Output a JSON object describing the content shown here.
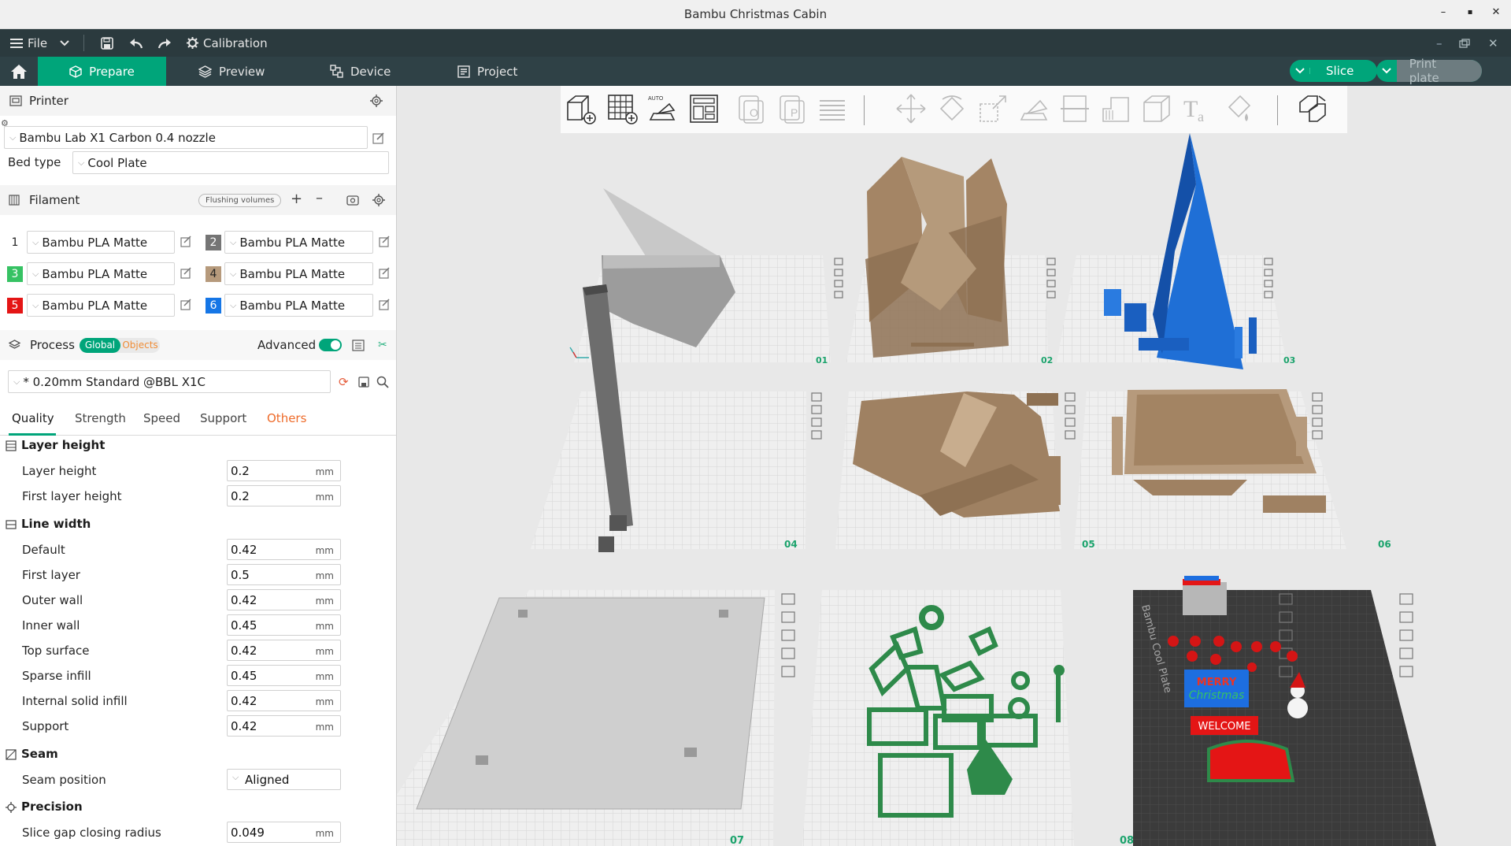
{
  "window": {
    "title": "Bambu Christmas Cabin",
    "controls": [
      "–",
      "▪",
      "✕"
    ]
  },
  "menubar": {
    "file_label": "File",
    "calibration_label": "Calibration"
  },
  "tabs": {
    "prepare": "Prepare",
    "preview": "Preview",
    "device": "Device",
    "project": "Project"
  },
  "actions": {
    "slice": "Slice",
    "print_plate": "Print plate"
  },
  "printer": {
    "section_title": "Printer",
    "preset": "Bambu Lab X1 Carbon 0.4 nozzle",
    "bed_type_label": "Bed type",
    "bed_type_value": "Cool Plate"
  },
  "filament": {
    "section_title": "Filament",
    "flushing_label": "Flushing volumes",
    "slots": [
      {
        "num": "1",
        "color": "#ffffff",
        "name": "Bambu PLA Matte"
      },
      {
        "num": "2",
        "color": "#757575",
        "name": "Bambu PLA Matte"
      },
      {
        "num": "3",
        "color": "#36c263",
        "name": "Bambu PLA Matte"
      },
      {
        "num": "4",
        "color": "#b69a7c",
        "name": "Bambu PLA Matte"
      },
      {
        "num": "5",
        "color": "#e41515",
        "name": "Bambu PLA Matte"
      },
      {
        "num": "6",
        "color": "#1576e6",
        "name": "Bambu PLA Matte"
      }
    ]
  },
  "process": {
    "section_title": "Process",
    "global_label": "Global",
    "objects_label": "Objects",
    "advanced_label": "Advanced",
    "preset": "* 0.20mm Standard @BBL X1C",
    "tabs": [
      "Quality",
      "Strength",
      "Speed",
      "Support",
      "Others"
    ],
    "groups": {
      "layer_height": {
        "title": "Layer height",
        "rows": [
          {
            "label": "Layer height",
            "value": "0.2",
            "unit": "mm"
          },
          {
            "label": "First layer height",
            "value": "0.2",
            "unit": "mm"
          }
        ]
      },
      "line_width": {
        "title": "Line width",
        "rows": [
          {
            "label": "Default",
            "value": "0.42",
            "unit": "mm"
          },
          {
            "label": "First layer",
            "value": "0.5",
            "unit": "mm"
          },
          {
            "label": "Outer wall",
            "value": "0.42",
            "unit": "mm"
          },
          {
            "label": "Inner wall",
            "value": "0.45",
            "unit": "mm"
          },
          {
            "label": "Top surface",
            "value": "0.42",
            "unit": "mm"
          },
          {
            "label": "Sparse infill",
            "value": "0.45",
            "unit": "mm"
          },
          {
            "label": "Internal solid infill",
            "value": "0.42",
            "unit": "mm"
          },
          {
            "label": "Support",
            "value": "0.42",
            "unit": "mm"
          }
        ]
      },
      "seam": {
        "title": "Seam",
        "rows": [
          {
            "label": "Seam position",
            "value": "Aligned"
          }
        ]
      },
      "precision": {
        "title": "Precision",
        "rows": [
          {
            "label": "Slice gap closing radius",
            "value": "0.049",
            "unit": "mm"
          }
        ]
      }
    }
  },
  "plates": {
    "labels": [
      "01",
      "02",
      "03",
      "04",
      "05",
      "06",
      "07",
      "08"
    ],
    "plate9_text": "Bambu Cool Plate",
    "sign_merry": "MERRY",
    "sign_christmas": "Christmas",
    "sign_welcome": "WELCOME"
  },
  "colors": {
    "accent": "#00a57a",
    "topbar": "#2f4146",
    "menubar": "#2b3a3e"
  }
}
